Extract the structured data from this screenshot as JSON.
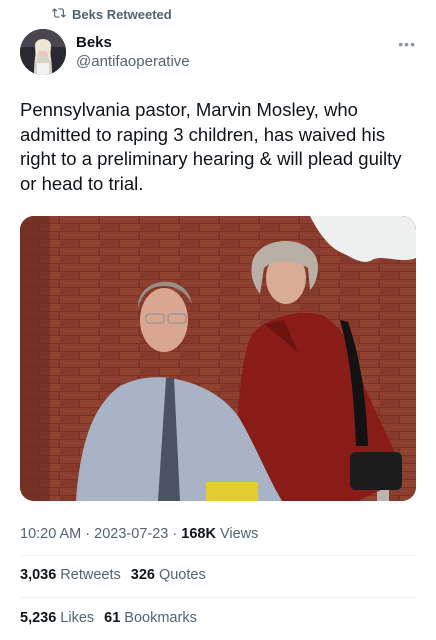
{
  "retweet": {
    "label": "Beks Retweeted",
    "icon": "retweet-icon"
  },
  "author": {
    "display_name": "Beks",
    "handle": "@antifaoperative"
  },
  "more_icon": "more-icon",
  "tweet": {
    "text": "Pennsylvania pastor, Marvin Mosley, who admitted to raping 3 children, has waived his right to a preliminary hearing & will plead guilty or head to trial."
  },
  "meta": {
    "time": "10:20 AM",
    "sep1": "·",
    "date": "2023-07-23",
    "sep2": "·",
    "views_count": "168K",
    "views_label": "Views"
  },
  "stats_row1": [
    {
      "count": "3,036",
      "label": "Retweets"
    },
    {
      "count": "326",
      "label": "Quotes"
    }
  ],
  "stats_row2": [
    {
      "count": "5,236",
      "label": "Likes"
    },
    {
      "count": "61",
      "label": "Bookmarks"
    }
  ],
  "colors": {
    "text": "#0f1419",
    "secondary": "#536471",
    "divider": "#eff3f4"
  }
}
